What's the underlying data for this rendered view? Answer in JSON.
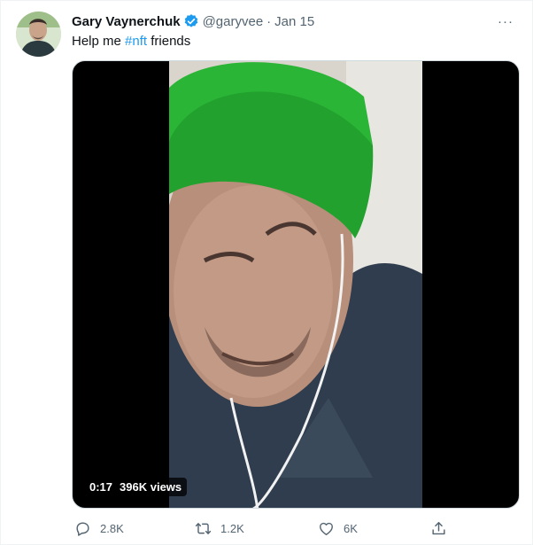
{
  "tweet": {
    "author_name": "Gary Vaynerchuk",
    "handle": "@garyvee",
    "separator": "·",
    "date": "Jan 15",
    "text_before": "Help me ",
    "hashtag": "#nft",
    "text_after": " friends",
    "more_label": "···"
  },
  "media": {
    "duration": "0:17",
    "views": "396K views"
  },
  "actions": {
    "replies": "2.8K",
    "retweets": "1.2K",
    "likes": "6K"
  },
  "colors": {
    "accent": "#1d9bf0",
    "secondary_text": "#536471",
    "hat": "#22a12e"
  }
}
